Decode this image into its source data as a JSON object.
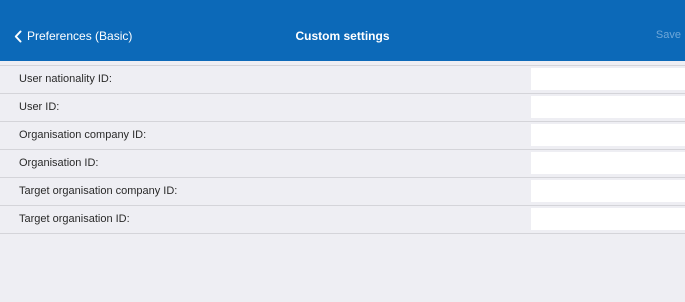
{
  "navbar": {
    "back_label": "Preferences (Basic)",
    "title": "Custom settings",
    "save_label": "Save"
  },
  "fields": [
    {
      "label": "User nationality ID:",
      "value": ""
    },
    {
      "label": "User ID:",
      "value": ""
    },
    {
      "label": "Organisation company ID:",
      "value": ""
    },
    {
      "label": "Organisation ID:",
      "value": ""
    },
    {
      "label": "Target organisation company ID:",
      "value": ""
    },
    {
      "label": "Target organisation ID:",
      "value": ""
    }
  ],
  "colors": {
    "navbar": "#0c69b8",
    "background": "#eeeef3",
    "save_disabled": "#6ea7d9"
  },
  "icons": {
    "back": "chevron-left-icon"
  }
}
